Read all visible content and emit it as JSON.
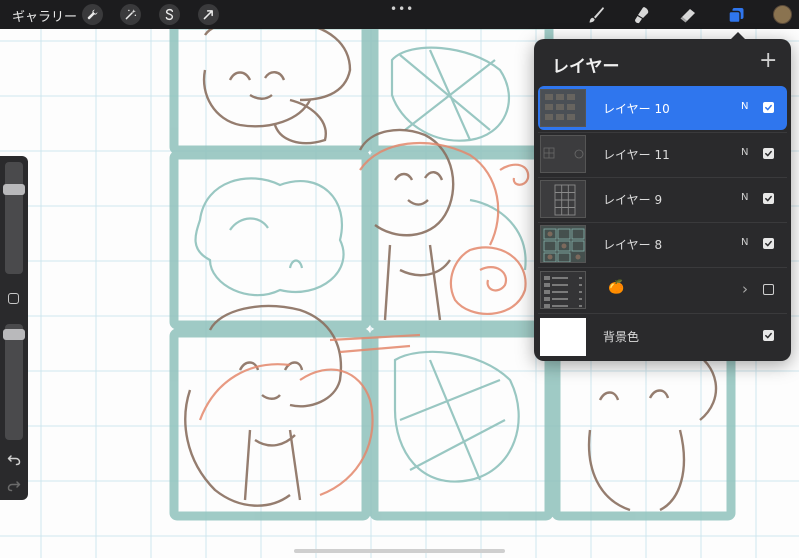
{
  "topbar": {
    "gallery_label": "ギャラリー",
    "actions": [
      {
        "icon": "wrench-icon"
      },
      {
        "icon": "magic-wand-icon"
      },
      {
        "icon": "selection-s-icon"
      },
      {
        "icon": "transform-arrow-icon"
      }
    ],
    "more_label": "•••",
    "tools": [
      {
        "icon": "brush-icon"
      },
      {
        "icon": "smudge-icon"
      },
      {
        "icon": "eraser-icon"
      },
      {
        "icon": "layers-icon",
        "active": true
      }
    ],
    "color_swatch": "#8a7350"
  },
  "layers_panel": {
    "title": "レイヤー",
    "add_label": "+",
    "layers": [
      {
        "name": "レイヤー 10",
        "mode": "N",
        "visible": true,
        "active": true
      },
      {
        "name": "レイヤー 11",
        "mode": "N",
        "visible": true,
        "active": false
      },
      {
        "name": "レイヤー 9",
        "mode": "N",
        "visible": true,
        "active": false
      },
      {
        "name": "レイヤー 8",
        "mode": "N",
        "visible": true,
        "active": false
      },
      {
        "name": "🍊",
        "mode": "",
        "visible": false,
        "active": false,
        "group": true
      },
      {
        "name": "背景色",
        "mode": "",
        "visible": true,
        "active": false
      }
    ]
  },
  "sidebar": {
    "brush_size_level": 0.78,
    "opacity_level": 0.95
  },
  "colors": {
    "accent": "#2f76ee",
    "sketch_teal": "#8fc2bc",
    "sketch_brown": "#8a7060",
    "sketch_red": "#e4886c"
  }
}
